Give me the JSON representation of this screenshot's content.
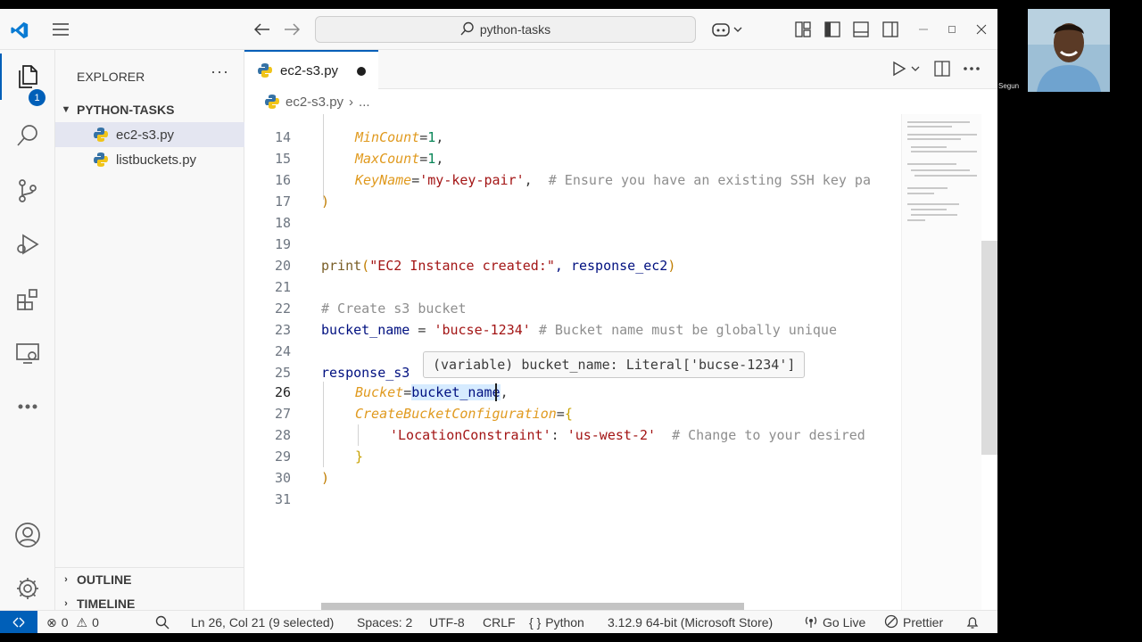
{
  "title_bar": {
    "search_text": "python-tasks"
  },
  "activity_bar": {
    "explorer_badge": "1"
  },
  "sidebar": {
    "header": "EXPLORER",
    "more": "···",
    "folder": "PYTHON-TASKS",
    "files": [
      "ec2-s3.py",
      "listbuckets.py"
    ],
    "outline": "OUTLINE",
    "timeline": "TIMELINE"
  },
  "tabs": [
    {
      "label": "ec2-s3.py",
      "modified": true
    }
  ],
  "breadcrumb": {
    "file": "ec2-s3.py",
    "sep": "›",
    "more": "..."
  },
  "editor": {
    "line_numbers": [
      "14",
      "15",
      "16",
      "17",
      "18",
      "19",
      "20",
      "21",
      "22",
      "23",
      "24",
      "25",
      "26",
      "27",
      "28",
      "29",
      "30",
      "31"
    ],
    "current_line": "26",
    "hover": "(variable) bucket_name: Literal['bucse-1234']",
    "lines": {
      "l14_a": "MinCount",
      "l14_b": "=",
      "l14_c": "1",
      "l14_d": ",",
      "l15_a": "MaxCount",
      "l15_b": "=",
      "l15_c": "1",
      "l15_d": ",",
      "l16_a": "KeyName",
      "l16_b": "=",
      "l16_c": "'my-key-pair'",
      "l16_d": ",  ",
      "l16_e": "# Ensure you have an existing SSH key pa",
      "l17": ")",
      "l20_a": "print",
      "l20_b": "(",
      "l20_c": "\"EC2 Instance created:\"",
      "l20_d": ", response_ec2",
      "l20_e": ")",
      "l22": "# Create s3 bucket",
      "l23_a": "bucket_name",
      "l23_b": " = ",
      "l23_c": "'bucse-1234'",
      "l23_d": " # Bucket name must be globally unique",
      "l25": "response_s3",
      "l26_a": "Bucket",
      "l26_b": "=",
      "l26_c": "bucket_name",
      "l26_d": ",",
      "l27_a": "CreateBucketConfiguration",
      "l27_b": "=",
      "l27_c": "{",
      "l28_a": "'LocationConstraint'",
      "l28_b": ": ",
      "l28_c": "'us-west-2'",
      "l28_d": "  # Change to your desired",
      "l29": "}",
      "l30": ")"
    }
  },
  "status_bar": {
    "errors": "0",
    "warnings": "0",
    "position": "Ln 26, Col 21 (9 selected)",
    "spaces": "Spaces: 2",
    "encoding": "UTF-8",
    "eol": "CRLF",
    "language": "Python",
    "interpreter": "3.12.9 64-bit (Microsoft Store)",
    "go_live": "Go Live",
    "prettier": "Prettier"
  },
  "webcam": {
    "name": "Segun"
  },
  "colors": {
    "accent": "#005fb8",
    "string": "#a31515",
    "number": "#098658",
    "comment": "#8e8e8e",
    "function": "#795e26",
    "param": "#e09a1f"
  }
}
